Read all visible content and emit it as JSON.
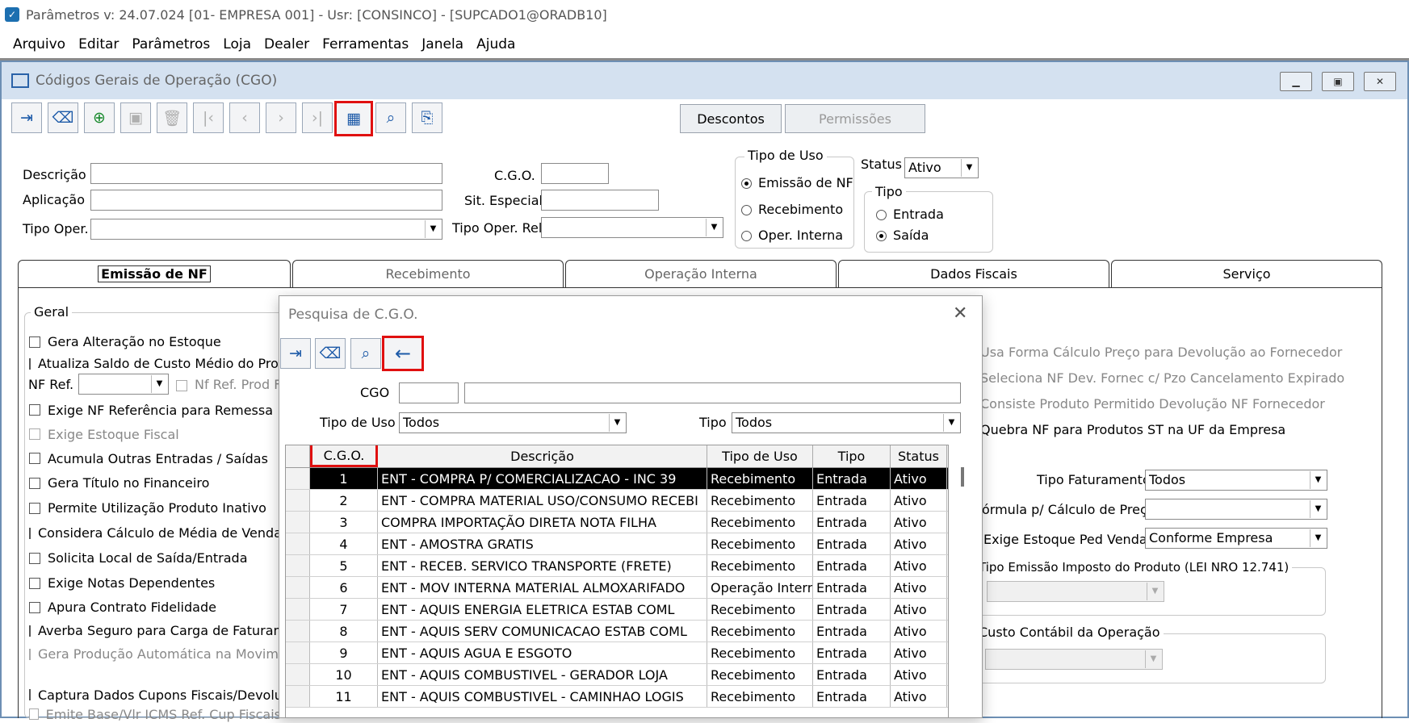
{
  "titlebar": {
    "title": "Parâmetros  v: 24.07.024  [01- EMPRESA 001] - Usr: [CONSINCO] - [SUPCADO1@ORADB10]"
  },
  "menu": [
    "Arquivo",
    "Editar",
    "Parâmetros",
    "Loja",
    "Dealer",
    "Ferramentas",
    "Janela",
    "Ajuda"
  ],
  "window": {
    "title": "Códigos Gerais de Operação (CGO)"
  },
  "buttons": {
    "descontos": "Descontos",
    "permissoes": "Permissões"
  },
  "form": {
    "descricao_label": "Descrição",
    "aplicacao_label": "Aplicação",
    "tipo_oper_label": "Tipo Oper.",
    "cgo_label": "C.G.O.",
    "sit_especial_label": "Sit. Especial",
    "tipo_oper_rel_label": "Tipo Oper. Rel.",
    "tipo_uso_title": "Tipo de Uso",
    "tipo_uso_options": [
      "Emissão de NF",
      "Recebimento",
      "Oper. Interna"
    ],
    "status_label": "Status",
    "status_value": "Ativo",
    "tipo_title": "Tipo",
    "tipo_options": [
      "Entrada",
      "Saída"
    ]
  },
  "tabs": [
    "Emissão de NF",
    "Recebimento",
    "Operação Interna",
    "Dados Fiscais",
    "Serviço"
  ],
  "geral": {
    "title": "Geral",
    "items": [
      "Gera Alteração no Estoque",
      "Atualiza Saldo de Custo Médio do Produ"
    ],
    "nf_ref_label": "NF Ref.",
    "nf_ref_prod": "Nf Ref. Prod F",
    "items2": [
      "Exige NF Referência para Remessa",
      "Exige Estoque Fiscal",
      "Acumula Outras Entradas / Saídas",
      "Gera Título no Financeiro",
      "Permite Utilização Produto Inativo",
      "Considera Cálculo de Média de Vendas",
      "Solicita Local de Saída/Entrada",
      "Exige Notas Dependentes",
      "Apura Contrato Fidelidade",
      "Averba Seguro para Carga de Faturame",
      "Gera Produção Automática na Movimen"
    ],
    "items3": [
      "Captura Dados Cupons Fiscais/Devoluç",
      "Emite Base/Vlr ICMS Ref. Cup Fiscais"
    ]
  },
  "right": {
    "checks": [
      "Usa Forma Cálculo Preço para Devolução ao Fornecedor",
      "Seleciona NF Dev. Fornec c/ Pzo Cancelamento Expirado",
      "Consiste Produto Permitido Devolução NF Fornecedor",
      "Quebra NF para Produtos ST na UF da Empresa"
    ],
    "tipo_fat_label": "Tipo Faturamento",
    "tipo_fat_value": "Todos",
    "formula_label": "órmula p/ Cálculo de Preço",
    "exige_est_label": "Exige Estoque Ped Venda",
    "exige_est_value": "Conforme Empresa",
    "tipo_emissao_title": "Tipo Emissão Imposto do Produto (LEI NRO 12.741)",
    "custo_title": "Custo Contábil da Operação"
  },
  "modal": {
    "title": "Pesquisa de C.G.O.",
    "cgo_label": "CGO",
    "tipo_uso_label": "Tipo de Uso",
    "tipo_uso_value": "Todos",
    "tipo_label": "Tipo",
    "tipo_value": "Todos",
    "columns": [
      "C.G.O.",
      "Descrição",
      "Tipo de Uso",
      "Tipo",
      "Status"
    ],
    "rows": [
      [
        "1",
        "ENT - COMPRA P/ COMERCIALIZACAO - INC 39",
        "Recebimento",
        "Entrada",
        "Ativo"
      ],
      [
        "2",
        "ENT - COMPRA MATERIAL USO/CONSUMO RECEBI",
        "Recebimento",
        "Entrada",
        "Ativo"
      ],
      [
        "3",
        "COMPRA IMPORTAÇÃO DIRETA NOTA FILHA",
        "Recebimento",
        "Entrada",
        "Ativo"
      ],
      [
        "4",
        "ENT - AMOSTRA GRATIS",
        "Recebimento",
        "Entrada",
        "Ativo"
      ],
      [
        "5",
        "ENT - RECEB. SERVICO TRANSPORTE (FRETE)",
        "Recebimento",
        "Entrada",
        "Ativo"
      ],
      [
        "6",
        "ENT - MOV INTERNA MATERIAL ALMOXARIFADO",
        "Operação Interna",
        "Entrada",
        "Ativo"
      ],
      [
        "7",
        "ENT - AQUIS ENERGIA ELETRICA ESTAB COML",
        "Recebimento",
        "Entrada",
        "Ativo"
      ],
      [
        "8",
        "ENT - AQUIS SERV COMUNICACAO ESTAB COML",
        "Recebimento",
        "Entrada",
        "Ativo"
      ],
      [
        "9",
        "ENT - AQUIS AGUA E ESGOTO",
        "Recebimento",
        "Entrada",
        "Ativo"
      ],
      [
        "10",
        "ENT - AQUIS COMBUSTIVEL - GERADOR LOJA",
        "Recebimento",
        "Entrada",
        "Ativo"
      ],
      [
        "11",
        "ENT - AQUIS COMBUSTIVEL - CAMINHAO LOGIS",
        "Recebimento",
        "Entrada",
        "Ativo"
      ]
    ]
  }
}
